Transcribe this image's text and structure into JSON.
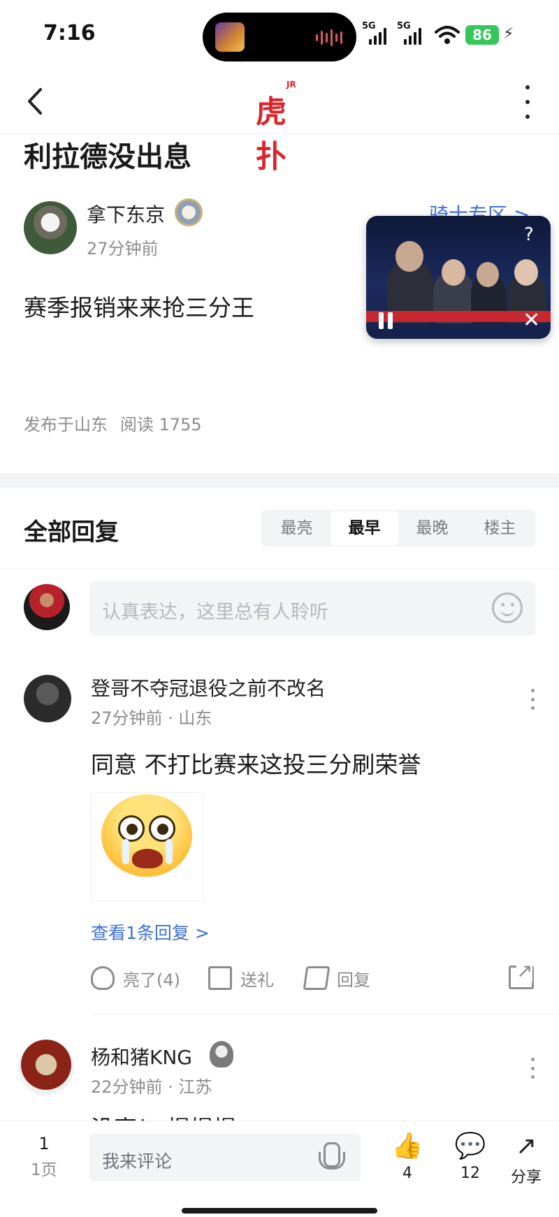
{
  "status_bar": {
    "time": "7:16",
    "signal1_label": "5G",
    "signal2_label": "5G",
    "battery": "86"
  },
  "nav": {
    "logo_text": "虎扑",
    "logo_sup": "JR"
  },
  "post": {
    "title": "利拉德没出息",
    "author_name": "拿下东京",
    "author_time": "27分钟前",
    "zone_link": "骑士专区 >",
    "body": "赛季报销来来抢三分王",
    "meta_location": "发布于山东",
    "meta_reads": "阅读 1755"
  },
  "replies": {
    "title": "全部回复",
    "sort_tabs": [
      "最亮",
      "最早",
      "最晚",
      "楼主"
    ],
    "active_sort": "最早",
    "comment_placeholder": "认真表达，这里总有人聆听"
  },
  "reply1": {
    "name": "登哥不夺冠退役之前不改名",
    "time": "27分钟前 · 山东",
    "text": "同意 不打比赛来这投三分刷荣誉",
    "view_replies": "查看1条回复 >",
    "like_label": "亮了(4)",
    "gift_label": "送礼",
    "reply_label": "回复"
  },
  "reply2": {
    "name": "杨和猪KNG",
    "time": "22分钟前 · 江苏",
    "text_peek": "没事！ 慢慢慢"
  },
  "bottom_bar": {
    "page_number": "1",
    "page_label": "1页",
    "input_placeholder": "我来评论",
    "likes": "4",
    "comments": "12",
    "share_label": "分享"
  },
  "colors": {
    "brand_red": "#d8262e",
    "link_blue": "#3d6fd6",
    "battery_green": "#34c759",
    "muted_gray": "#8c8c8c"
  }
}
